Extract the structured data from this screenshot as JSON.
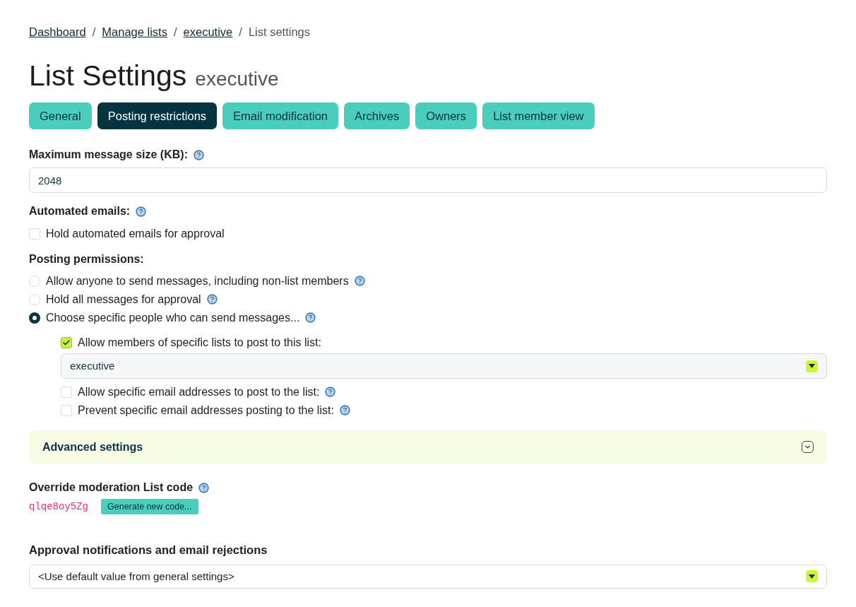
{
  "breadcrumbs": [
    {
      "label": "Dashboard",
      "link": true
    },
    {
      "label": "Manage lists",
      "link": true
    },
    {
      "label": "executive",
      "link": true
    },
    {
      "label": "List settings",
      "link": false
    }
  ],
  "breadcrumb_separator": "/",
  "title": "List Settings",
  "subtitle": "executive",
  "tabs": [
    {
      "label": "General",
      "selected": false
    },
    {
      "label": "Posting restrictions",
      "selected": true
    },
    {
      "label": "Email modification",
      "selected": false
    },
    {
      "label": "Archives",
      "selected": false
    },
    {
      "label": "Owners",
      "selected": false
    },
    {
      "label": "List member view",
      "selected": false
    }
  ],
  "max_size": {
    "label": "Maximum message size (KB):",
    "help": true,
    "value": "2048"
  },
  "automated": {
    "label": "Automated emails:",
    "help": true,
    "options": [
      {
        "label": "Hold automated emails for approval",
        "checked": false
      }
    ]
  },
  "permissions": {
    "label": "Posting permissions:",
    "options": [
      {
        "label": "Allow anyone to send messages, including non-list members",
        "help": true,
        "selected": false
      },
      {
        "label": "Hold all messages for approval",
        "help": true,
        "selected": false
      },
      {
        "label": "Choose specific people who can send messages...",
        "help": true,
        "selected": true
      }
    ],
    "sub_options": [
      {
        "label": "Allow members of specific lists to post to this list:",
        "help": false,
        "checked": true,
        "select_value": "executive"
      },
      {
        "label": "Allow specific email addresses to post to the list:",
        "help": true,
        "checked": false
      },
      {
        "label": "Prevent specific email addresses posting to the list:",
        "help": true,
        "checked": false
      }
    ]
  },
  "advanced": {
    "label": "Advanced settings",
    "expanded": false
  },
  "override": {
    "label": "Override moderation List code",
    "help": true,
    "code": "qlqe8oy5Zg",
    "button": "Generate new code..."
  },
  "approval": {
    "label": "Approval notifications and email rejections",
    "value": "<Use default value from general settings>"
  }
}
